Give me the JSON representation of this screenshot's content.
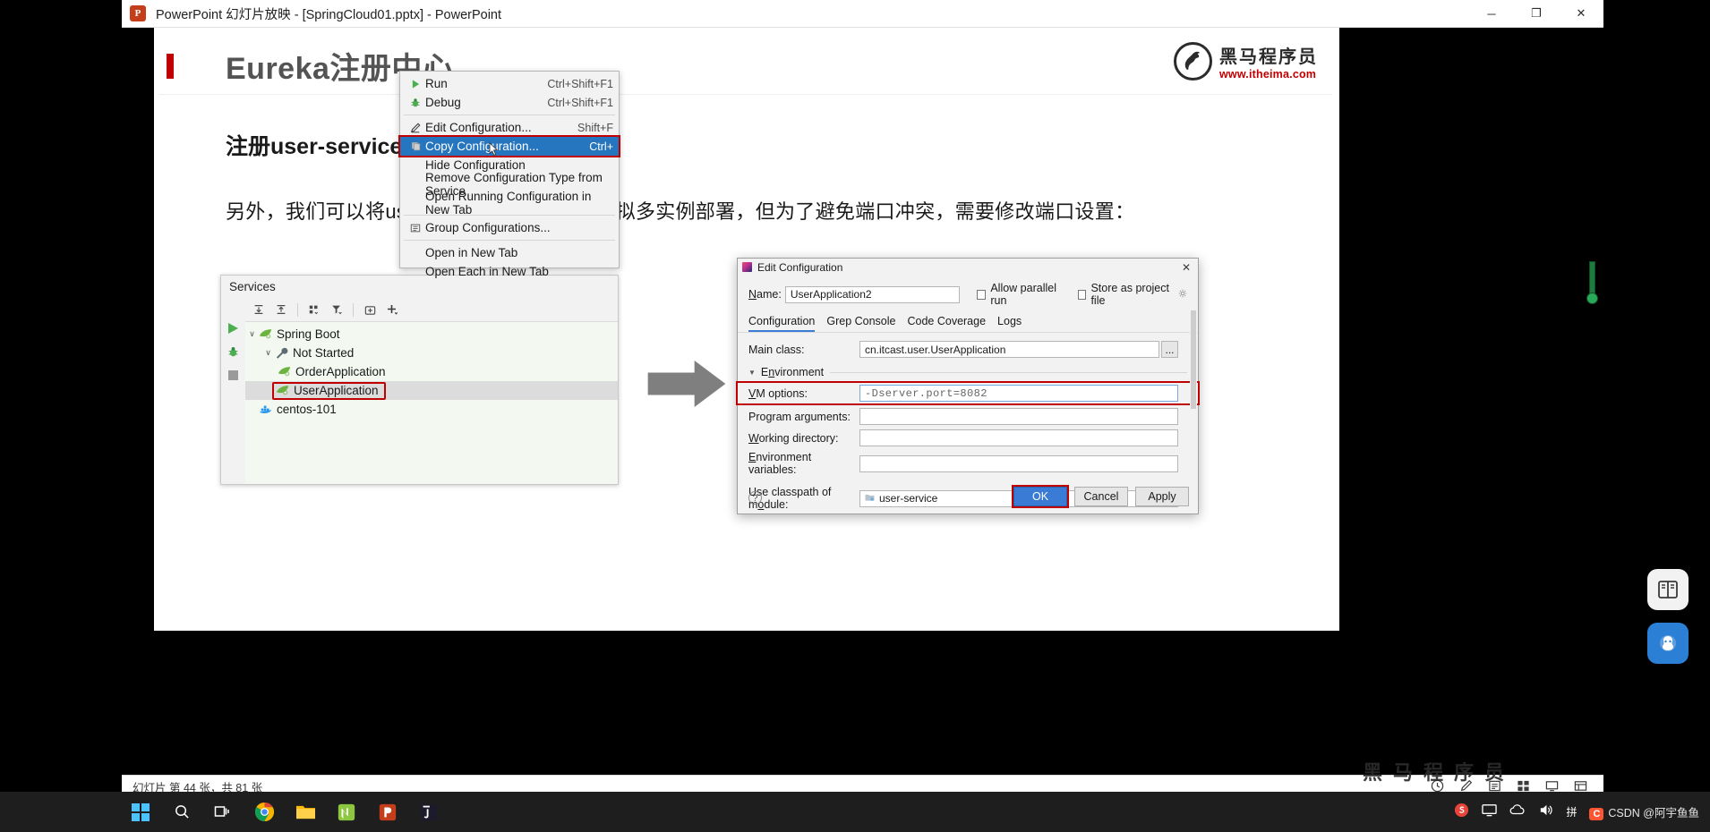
{
  "window": {
    "title": "PowerPoint 幻灯片放映 - [SpringCloud01.pptx] - PowerPoint",
    "app_icon": "P",
    "minimize": "─",
    "maximize": "❐",
    "close": "✕"
  },
  "slide": {
    "title": "Eureka注册中心",
    "heading": "注册user-service",
    "paragraph": "另外，我们可以将user-service多次启动，模拟多实例部署，但为了避免端口冲突，需要修改端口设置：",
    "logo": {
      "cn": "黑马程序员",
      "url": "www.itheima.com"
    },
    "watermark": "黑马程序员"
  },
  "services_panel": {
    "title": "Services",
    "gutter": [
      "run-icon",
      "debug-icon",
      "stop-icon"
    ],
    "toolbar": [
      "expand-all-icon",
      "collapse-all-icon",
      "group-icon",
      "filter-icon",
      "add-tab-icon",
      "plus-icon"
    ],
    "tree": [
      {
        "label": "Spring Boot",
        "level": 0,
        "chevron": "∨",
        "icon": "spring-leaf-icon",
        "selected": false,
        "highlight": false
      },
      {
        "label": "Not Started",
        "level": 1,
        "chevron": "∨",
        "icon": "wrench-icon",
        "selected": false,
        "highlight": false
      },
      {
        "label": "OrderApplication",
        "level": 2,
        "chevron": "",
        "icon": "spring-leaf-icon",
        "selected": false,
        "highlight": false
      },
      {
        "label": "UserApplication",
        "level": 2,
        "chevron": "",
        "icon": "spring-leaf-icon",
        "selected": true,
        "highlight": true
      },
      {
        "label": "centos-101",
        "level": 0,
        "chevron": "",
        "icon": "docker-icon",
        "selected": false,
        "highlight": false
      }
    ]
  },
  "context_menu": {
    "items": [
      {
        "label": "Run",
        "shortcut": "Ctrl+Shift+F1",
        "icon": "run-icon",
        "highlighted": false,
        "separator_after": false
      },
      {
        "label": "Debug",
        "shortcut": "Ctrl+Shift+F1",
        "icon": "debug-icon",
        "highlighted": false,
        "separator_after": true
      },
      {
        "label": "Edit Configuration...",
        "shortcut": "Shift+F",
        "icon": "pencil-icon",
        "highlighted": false,
        "separator_after": false
      },
      {
        "label": "Copy Configuration...",
        "shortcut": "Ctrl+",
        "icon": "copy-icon",
        "highlighted": true,
        "separator_after": false
      },
      {
        "label": "Hide Configuration",
        "shortcut": "",
        "icon": "",
        "highlighted": false,
        "separator_after": false
      },
      {
        "label": "Remove Configuration Type from Service",
        "shortcut": "",
        "icon": "",
        "highlighted": false,
        "separator_after": false
      },
      {
        "label": "Open Running Configuration in New Tab",
        "shortcut": "",
        "icon": "",
        "highlighted": false,
        "separator_after": true
      },
      {
        "label": "Group Configurations...",
        "shortcut": "",
        "icon": "group-icon",
        "highlighted": false,
        "separator_after": true
      },
      {
        "label": "Open in New Tab",
        "shortcut": "",
        "icon": "",
        "highlighted": false,
        "separator_after": false
      },
      {
        "label": "Open Each in New Tab",
        "shortcut": "",
        "icon": "",
        "highlighted": false,
        "separator_after": false
      }
    ]
  },
  "dialog": {
    "title": "Edit Configuration",
    "close": "✕",
    "name_label": "Name:",
    "name_value": "UserApplication2",
    "allow_parallel_run": "Allow parallel run",
    "store_as_project_file": "Store as project file",
    "tabs": [
      {
        "label": "Configuration",
        "active": true
      },
      {
        "label": "Grep Console",
        "active": false
      },
      {
        "label": "Code Coverage",
        "active": false
      },
      {
        "label": "Logs",
        "active": false
      }
    ],
    "main_class_label": "Main class:",
    "main_class_value": "cn.itcast.user.UserApplication",
    "browse_button": "...",
    "environment_label": "Environment",
    "fields": [
      {
        "label": "VM options:",
        "value": "-Dserver.port=8082",
        "highlighted": true,
        "mono": true,
        "focused": true
      },
      {
        "label": "Program arguments:",
        "value": "",
        "highlighted": false,
        "mono": false,
        "focused": false
      },
      {
        "label": "Working directory:",
        "value": "",
        "highlighted": false,
        "mono": false,
        "focused": false
      },
      {
        "label": "Environment variables:",
        "value": "",
        "highlighted": false,
        "mono": false,
        "focused": false
      }
    ],
    "classpath_label": "Use classpath of module:",
    "classpath_value": "user-service",
    "help": "?",
    "buttons": [
      {
        "label": "OK",
        "primary": true
      },
      {
        "label": "Cancel",
        "primary": false
      },
      {
        "label": "Apply",
        "primary": false
      }
    ]
  },
  "statusbar": {
    "text": "幻灯片 第 44 张，共 81 张",
    "icons": [
      "clock-icon",
      "pen-icon",
      "note-icon",
      "grid-icon",
      "display-icon",
      "more-icon"
    ]
  },
  "taskbar": {
    "left_items": [
      "start-icon",
      "search-icon",
      "task-view-icon",
      "chrome-icon",
      "explorer-icon",
      "notepadpp-icon",
      "powerpoint-icon",
      "idea-icon"
    ],
    "tray": [
      "s-icon",
      "screen-icon",
      "cloud-icon",
      "volume-icon",
      "ime-icon"
    ],
    "ime": "拼",
    "watermark": "CSDN @阿宇鱼鱼",
    "csdn_badge": "C"
  }
}
